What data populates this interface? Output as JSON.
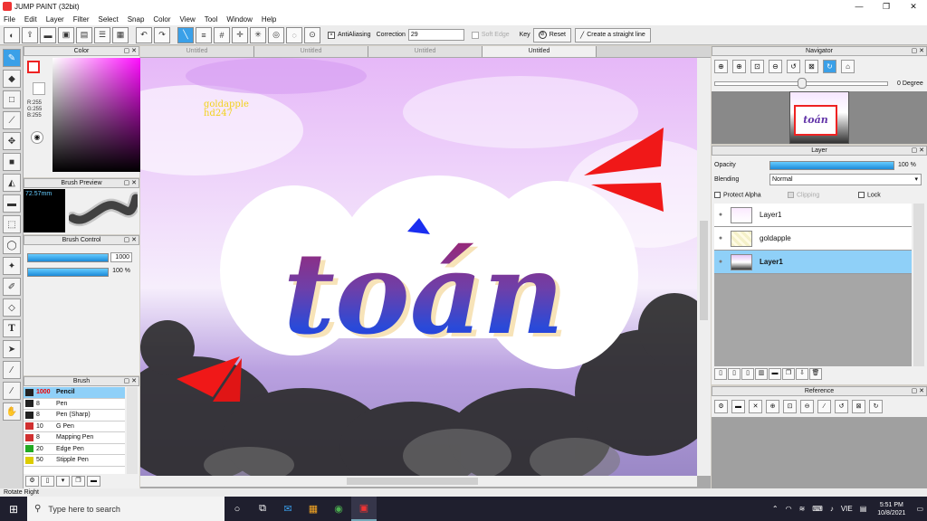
{
  "window": {
    "title": "JUMP PAINT (32bit)",
    "minimize": "—",
    "maximize": "❐",
    "close": "✕"
  },
  "menu": [
    "File",
    "Edit",
    "Layer",
    "Filter",
    "Select",
    "Snap",
    "Color",
    "View",
    "Tool",
    "Window",
    "Help"
  ],
  "toolbar": {
    "antialiasing_label": "AntiAliasing",
    "correction_label": "Correction",
    "correction_value": "29",
    "soft_edge_label": "Soft Edge",
    "key_label": "Key",
    "reset_label": "Reset",
    "straight_line_label": "Create a straight line"
  },
  "color_panel": {
    "title": "Color",
    "rgb": "R:255\nG:255\nB:255",
    "fg_color": "#ffffff",
    "hue_color": "#ff00ff"
  },
  "brush_preview": {
    "title": "Brush Preview",
    "size": "72.57mm"
  },
  "brush_control": {
    "title": "Brush Control",
    "size_value": "1000",
    "opacity_value": "100 %"
  },
  "brush_panel": {
    "title": "Brush",
    "items": [
      {
        "size": "1000",
        "name": "Pencil",
        "color": "#222222"
      },
      {
        "size": "8",
        "name": "Pen",
        "color": "#222222"
      },
      {
        "size": "8",
        "name": "Pen (Sharp)",
        "color": "#222222"
      },
      {
        "size": "10",
        "name": "G Pen",
        "color": "#d03030"
      },
      {
        "size": "8",
        "name": "Mapping Pen",
        "color": "#d03030"
      },
      {
        "size": "20",
        "name": "Edge Pen",
        "color": "#22aa22"
      },
      {
        "size": "50",
        "name": "Stipple Pen",
        "color": "#ddcc00"
      }
    ]
  },
  "canvas": {
    "tabs": [
      "Untitled",
      "Untitled",
      "Untitled",
      "Untitled"
    ],
    "artwork_text": "toán",
    "watermark": "goldapple\nhd247"
  },
  "navigator": {
    "title": "Navigator",
    "degree": "0 Degree",
    "thumb_text": "toán"
  },
  "layer_panel": {
    "title": "Layer",
    "opacity_label": "Opacity",
    "opacity_value": "100 %",
    "blending_label": "Blending",
    "blending_value": "Normal",
    "protect_alpha": "Protect Alpha",
    "clipping": "Clipping",
    "lock": "Lock",
    "layers": [
      {
        "name": "Layer1"
      },
      {
        "name": "goldapple"
      },
      {
        "name": "Layer1"
      }
    ]
  },
  "reference": {
    "title": "Reference"
  },
  "status": {
    "text": "Rotate Right"
  },
  "taskbar": {
    "search_placeholder": "Type here to search",
    "language": "VIE",
    "time": "5:51 PM",
    "date": "10/8/2021"
  }
}
